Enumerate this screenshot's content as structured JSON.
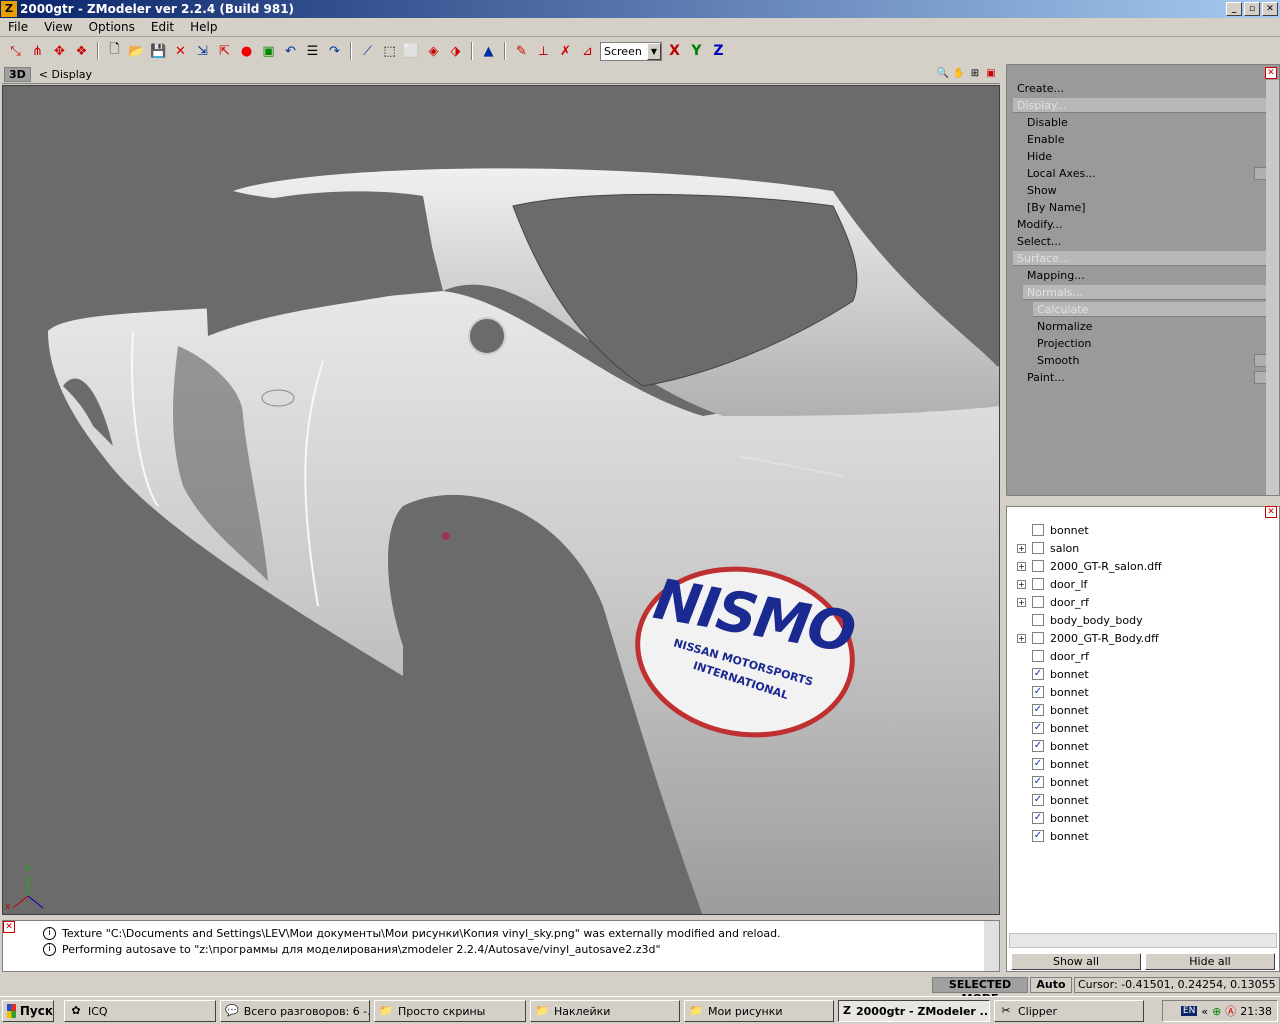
{
  "window": {
    "title": "2000gtr - ZModeler ver 2.2.4 (Build 981)",
    "app_icon": "Z"
  },
  "menu": [
    "File",
    "View",
    "Options",
    "Edit",
    "Help"
  ],
  "toolbar": {
    "view_select": "Screen",
    "axes": [
      "X",
      "Y",
      "Z"
    ],
    "axis_colors": {
      "x": "#c00000",
      "y": "#008000",
      "z": "#0000c0"
    }
  },
  "viewport": {
    "mode": "3D",
    "breadcrumb": "<  Display",
    "decal": {
      "brand": "NISMO",
      "line1": "NISSAN MOTORSPORTS",
      "line2": "INTERNATIONAL"
    },
    "axis_labels": {
      "x": "x",
      "z": "z"
    }
  },
  "commands": [
    {
      "label": "Create...",
      "level": 0,
      "hl": false
    },
    {
      "label": "Display...",
      "level": 0,
      "hl": true
    },
    {
      "label": "Disable",
      "level": 1,
      "hl": false
    },
    {
      "label": "Enable",
      "level": 1,
      "hl": false
    },
    {
      "label": "Hide",
      "level": 1,
      "hl": false
    },
    {
      "label": "Local Axes...",
      "level": 1,
      "hl": false,
      "check": true
    },
    {
      "label": "Show",
      "level": 1,
      "hl": false
    },
    {
      "label": "[By Name]",
      "level": 1,
      "hl": false
    },
    {
      "label": "Modify...",
      "level": 0,
      "hl": false
    },
    {
      "label": "Select...",
      "level": 0,
      "hl": false
    },
    {
      "label": "Surface...",
      "level": 0,
      "hl": true
    },
    {
      "label": "Mapping...",
      "level": 1,
      "hl": false
    },
    {
      "label": "Normals...",
      "level": 1,
      "hl": true
    },
    {
      "label": "Calculate",
      "level": 2,
      "hl": true
    },
    {
      "label": "Normalize",
      "level": 2,
      "hl": false
    },
    {
      "label": "Projection",
      "level": 2,
      "hl": false
    },
    {
      "label": "Smooth",
      "level": 2,
      "hl": false,
      "check": true
    },
    {
      "label": "Paint...",
      "level": 1,
      "hl": false,
      "check": true
    }
  ],
  "tree": [
    {
      "label": "bonnet",
      "expandable": false,
      "checked": false
    },
    {
      "label": "salon",
      "expandable": true,
      "checked": false
    },
    {
      "label": "2000_GT-R_salon.dff",
      "expandable": true,
      "checked": false
    },
    {
      "label": "door_lf",
      "expandable": true,
      "checked": false
    },
    {
      "label": "door_rf",
      "expandable": true,
      "checked": false
    },
    {
      "label": "body_body_body",
      "expandable": false,
      "checked": false
    },
    {
      "label": "2000_GT-R_Body.dff",
      "expandable": true,
      "checked": false
    },
    {
      "label": "door_rf",
      "expandable": false,
      "checked": false
    },
    {
      "label": "bonnet",
      "expandable": false,
      "checked": true
    },
    {
      "label": "bonnet",
      "expandable": false,
      "checked": true
    },
    {
      "label": "bonnet",
      "expandable": false,
      "checked": true
    },
    {
      "label": "bonnet",
      "expandable": false,
      "checked": true
    },
    {
      "label": "bonnet",
      "expandable": false,
      "checked": true
    },
    {
      "label": "bonnet",
      "expandable": false,
      "checked": true
    },
    {
      "label": "bonnet",
      "expandable": false,
      "checked": true
    },
    {
      "label": "bonnet",
      "expandable": false,
      "checked": true
    },
    {
      "label": "bonnet",
      "expandable": false,
      "checked": true
    },
    {
      "label": "bonnet",
      "expandable": false,
      "checked": true
    }
  ],
  "tree_buttons": {
    "show_all": "Show all",
    "hide_all": "Hide all"
  },
  "log": [
    "Texture \"C:\\Documents and Settings\\LEV\\Мои документы\\Мои рисунки\\Копия vinyl_sky.png\" was externally modified and reload.",
    "Performing autosave to \"z:\\программы для моделирования\\zmodeler 2.2.4/Autosave/vinyl_autosave2.z3d\""
  ],
  "status": {
    "mode": "SELECTED MODE",
    "auto": "Auto",
    "cursor": "Cursor: -0.41501, 0.24254, 0.13055"
  },
  "taskbar": {
    "start": "Пуск",
    "tasks": [
      {
        "label": "ICQ",
        "icon": "flower-icon",
        "active": false
      },
      {
        "label": "Всего разговоров: 6 -...",
        "icon": "chat-icon",
        "active": false
      },
      {
        "label": "Просто скрины",
        "icon": "folder-icon",
        "active": false
      },
      {
        "label": "Наклейки",
        "icon": "folder-icon",
        "active": false
      },
      {
        "label": "Мои рисунки",
        "icon": "folder-icon",
        "active": false
      },
      {
        "label": "2000gtr - ZModeler ...",
        "icon": "zmodeler-icon",
        "active": true
      },
      {
        "label": "Clipper",
        "icon": "clipper-icon",
        "active": false
      }
    ],
    "tray": {
      "lang": "EN",
      "time": "21:38"
    }
  }
}
